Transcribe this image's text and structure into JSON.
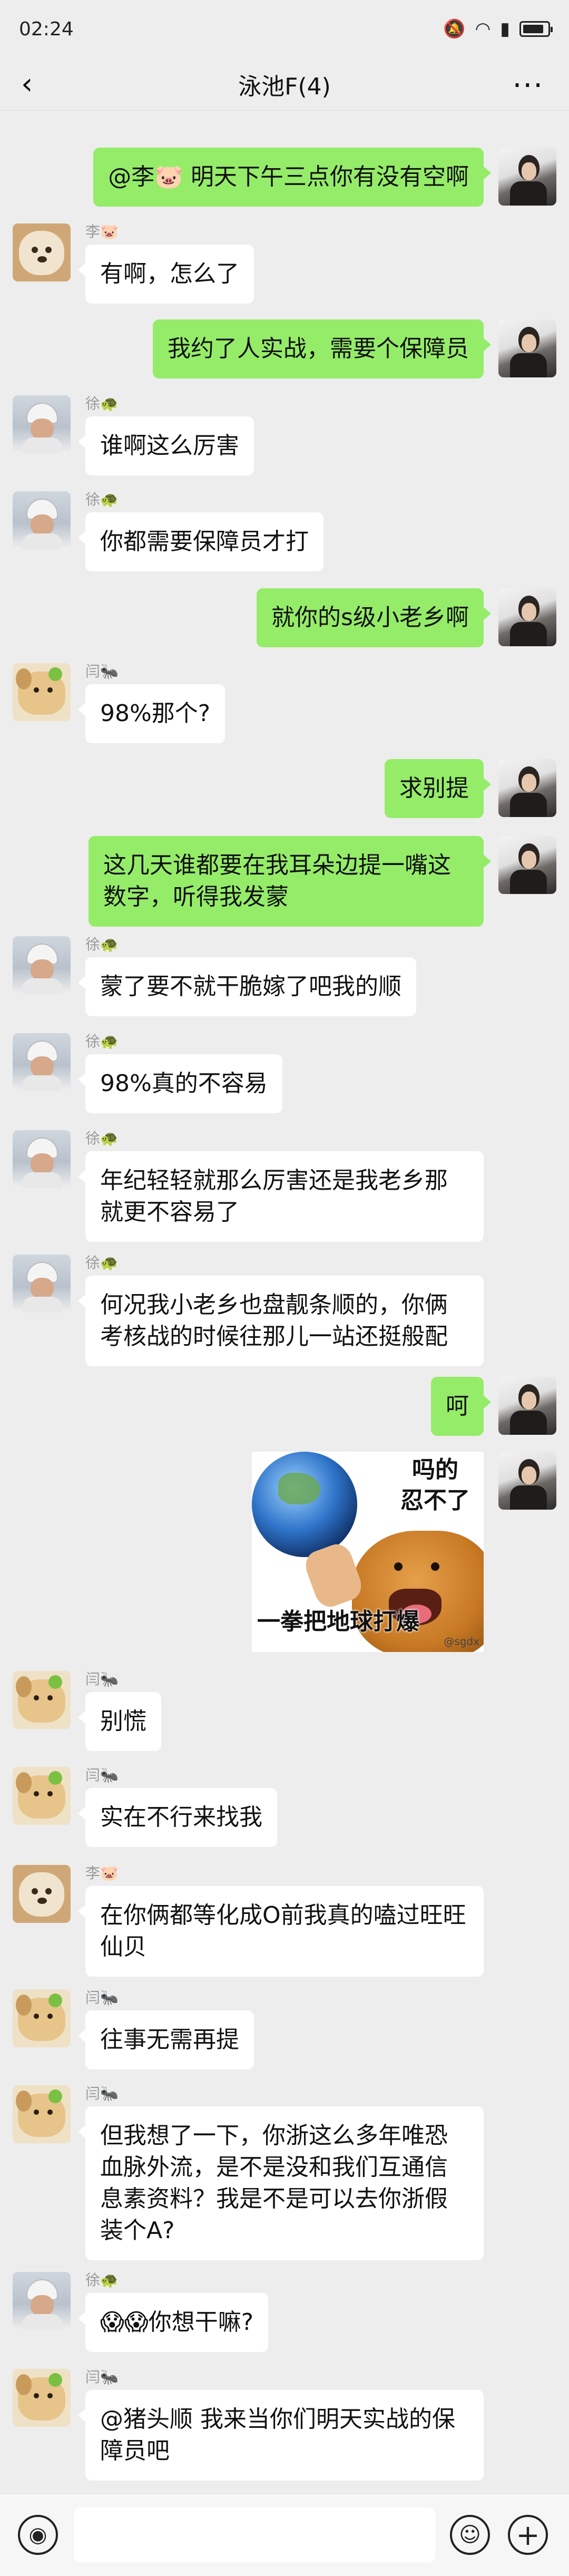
{
  "status_bar": {
    "time": "02:24"
  },
  "header": {
    "back_icon": "chevron-left-icon",
    "title": "泳池F(4)",
    "more_icon": "more-dots-icon"
  },
  "messages": [
    {
      "side": "right",
      "sender": "",
      "text": "@李🐷 明天下午三点你有没有空啊"
    },
    {
      "side": "left",
      "sender": "李🐷",
      "text": "有啊，怎么了"
    },
    {
      "side": "right",
      "sender": "",
      "text": "我约了人实战，需要个保障员"
    },
    {
      "side": "left",
      "sender": "徐🐢",
      "text": "谁啊这么厉害"
    },
    {
      "side": "left",
      "sender": "徐🐢",
      "text": "你都需要保障员才打"
    },
    {
      "side": "right",
      "sender": "",
      "text": "就你的s级小老乡啊"
    },
    {
      "side": "left",
      "sender": "闫🐜",
      "text": "98%那个?"
    },
    {
      "side": "right",
      "sender": "",
      "text": "求别提"
    },
    {
      "side": "right",
      "sender": "",
      "text": "这几天谁都要在我耳朵边提一嘴这数字，听得我发蒙"
    },
    {
      "side": "left",
      "sender": "徐🐢",
      "text": "蒙了要不就干脆嫁了吧我的顺"
    },
    {
      "side": "left",
      "sender": "徐🐢",
      "text": "98%真的不容易"
    },
    {
      "side": "left",
      "sender": "徐🐢",
      "text": "年纪轻轻就那么厉害还是我老乡那就更不容易了"
    },
    {
      "side": "left",
      "sender": "徐🐢",
      "text": "何况我小老乡也盘靓条顺的，你俩考核战的时候往那儿一站还挺般配"
    },
    {
      "side": "right",
      "sender": "",
      "text": "呵"
    },
    {
      "side": "left",
      "sender": "闫🐜",
      "text": "别慌"
    },
    {
      "side": "left",
      "sender": "闫🐜",
      "text": "实在不行来找我"
    },
    {
      "side": "left",
      "sender": "李🐷",
      "text": "在你俩都等化成O前我真的嗑过旺旺仙贝"
    },
    {
      "side": "left",
      "sender": "闫🐜",
      "text": "往事无需再提"
    },
    {
      "side": "left",
      "sender": "闫🐜",
      "text": "但我想了一下，你浙这么多年唯恐血脉外流，是不是没和我们互通信息素资料？我是不是可以去你浙假装个A?"
    },
    {
      "side": "left",
      "sender": "徐🐢",
      "text": "😱😱你想干嘛?"
    },
    {
      "side": "left",
      "sender": "闫🐜",
      "text": "@猪头顺 我来当你们明天实战的保障员吧"
    }
  ],
  "sticker": {
    "line1": "吗的",
    "line2": "忍不了",
    "caption": "一拳把地球打爆",
    "watermark": "@sgdx"
  },
  "input_bar": {
    "voice_icon": "voice-icon",
    "emoji_icon": "emoji-icon",
    "plus_icon": "plus-icon"
  }
}
